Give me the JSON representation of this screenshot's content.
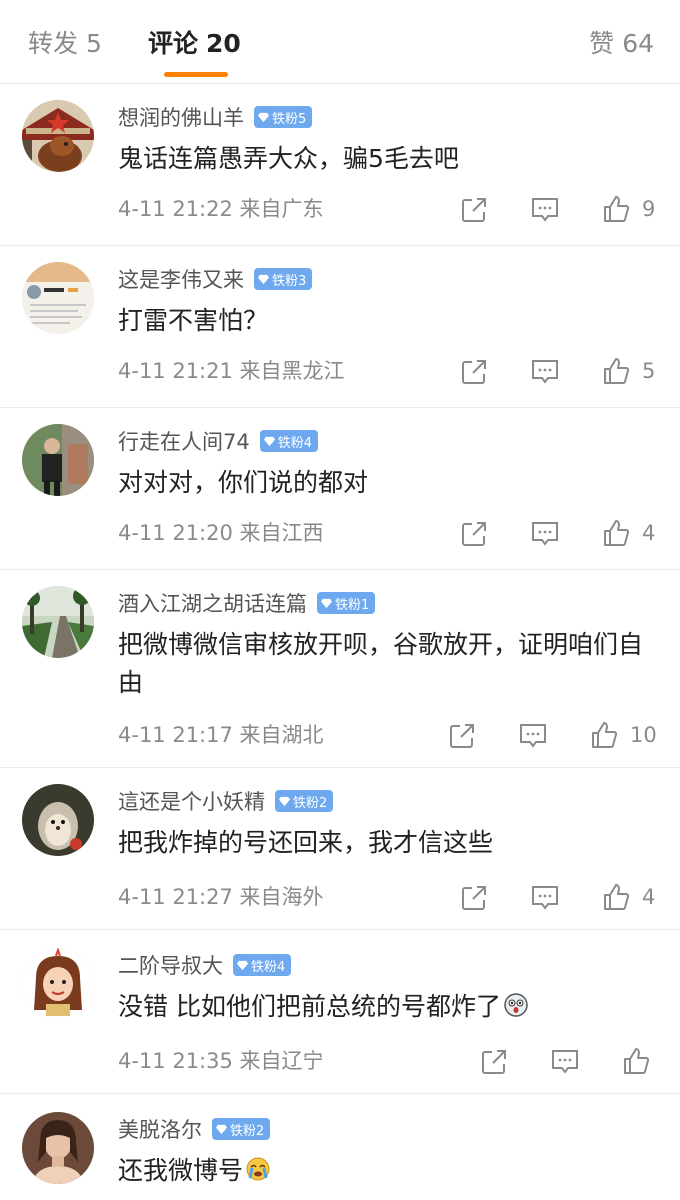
{
  "tabs": {
    "repost": {
      "label": "转发",
      "count": "5"
    },
    "comment": {
      "label": "评论",
      "count": "20"
    },
    "like": {
      "label": "赞",
      "count": "64"
    }
  },
  "colors": {
    "accent": "#ff8200",
    "badge": "#6ea9f0",
    "meta": "#8a8a8a"
  },
  "comments": [
    {
      "user": "想润的佛山羊",
      "badge": "铁粉5",
      "text": "鬼话连篇愚弄大众，骗5毛去吧",
      "time": "4-11 21:22",
      "location": "来自广东",
      "likes": "9"
    },
    {
      "user": "这是李伟又来",
      "badge": "铁粉3",
      "text": "打雷不害怕？",
      "time": "4-11 21:21",
      "location": "来自黑龙江",
      "likes": "5"
    },
    {
      "user": "行走在人间74",
      "badge": "铁粉4",
      "text": "对对对，你们说的都对",
      "time": "4-11 21:20",
      "location": "来自江西",
      "likes": "4"
    },
    {
      "user": "酒入江湖之胡话连篇",
      "badge": "铁粉1",
      "text": "把微博微信审核放开呗，谷歌放开，证明咱们自由",
      "time": "4-11 21:17",
      "location": "来自湖北",
      "likes": "10"
    },
    {
      "user": "這还是个小妖精",
      "badge": "铁粉2",
      "text": "把我炸掉的号还回来，我才信这些",
      "time": "4-11 21:27",
      "location": "来自海外",
      "likes": "4"
    },
    {
      "user": "二阶导叔大",
      "badge": "铁粉4",
      "text": "没错 比如他们把前总统的号都炸了",
      "emoji": "scared-face-emoji",
      "time": "4-11 21:35",
      "location": "来自辽宁",
      "likes": ""
    },
    {
      "user": "美脱洛尔",
      "badge": "铁粉2",
      "text": "还我微博号",
      "emoji": "crying-face-emoji",
      "time": "",
      "location": "",
      "likes": ""
    }
  ]
}
